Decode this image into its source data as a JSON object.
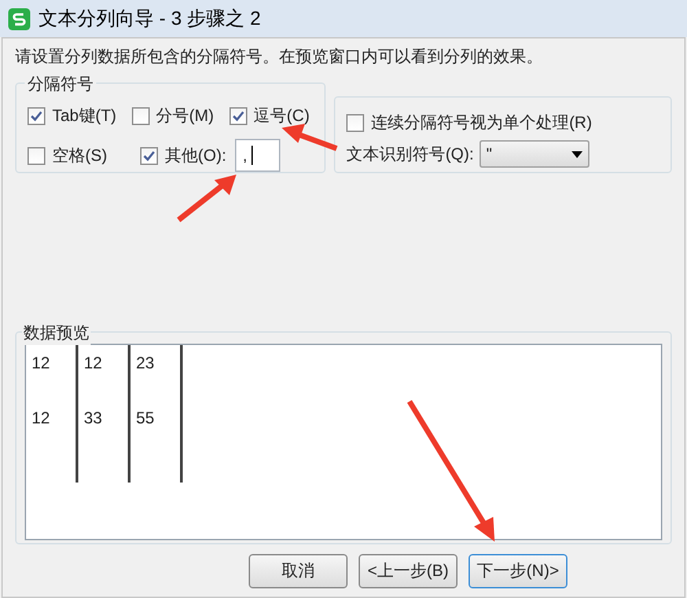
{
  "window": {
    "title": "文本分列向导 - 3 步骤之 2"
  },
  "instruction": "请设置分列数据所包含的分隔符号。在预览窗口内可以看到分列的效果。",
  "delimiters": {
    "title": "分隔符号",
    "options": [
      {
        "label": "Tab键(T)",
        "checked": true
      },
      {
        "label": "分号(M)",
        "checked": false
      },
      {
        "label": "逗号(C)",
        "checked": true
      },
      {
        "label": "空格(S)",
        "checked": false
      },
      {
        "label": "其他(O):",
        "checked": true
      }
    ],
    "other_value": ","
  },
  "consecutive": {
    "label": "连续分隔符号视为单个处理(R)",
    "checked": false
  },
  "qualifier": {
    "label": "文本识别符号(Q):",
    "value": "\""
  },
  "preview": {
    "title": "数据预览",
    "rows": [
      [
        "12",
        "12",
        "23"
      ],
      [
        "12",
        "33",
        "55"
      ]
    ]
  },
  "buttons": [
    {
      "label": "取消",
      "focused": false
    },
    {
      "label": "<上一步(B)",
      "focused": false
    },
    {
      "label": "下一步(N)>",
      "focused": true
    }
  ]
}
